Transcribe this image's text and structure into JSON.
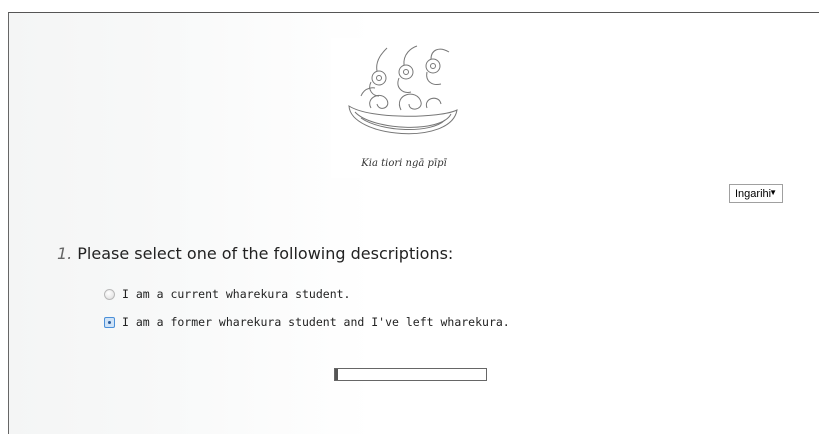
{
  "logo": {
    "caption": "Kia tiori ngā pīpī"
  },
  "language_select": {
    "selected": "Ingarihi"
  },
  "question": {
    "number": "1.",
    "text": "Please select one of the following descriptions:",
    "options": [
      {
        "label": "I am a current wharekura student.",
        "checked": false
      },
      {
        "label": "I am a former wharekura student and I've left wharekura.",
        "checked": true
      }
    ]
  },
  "progress": {
    "fraction": 0.02
  }
}
